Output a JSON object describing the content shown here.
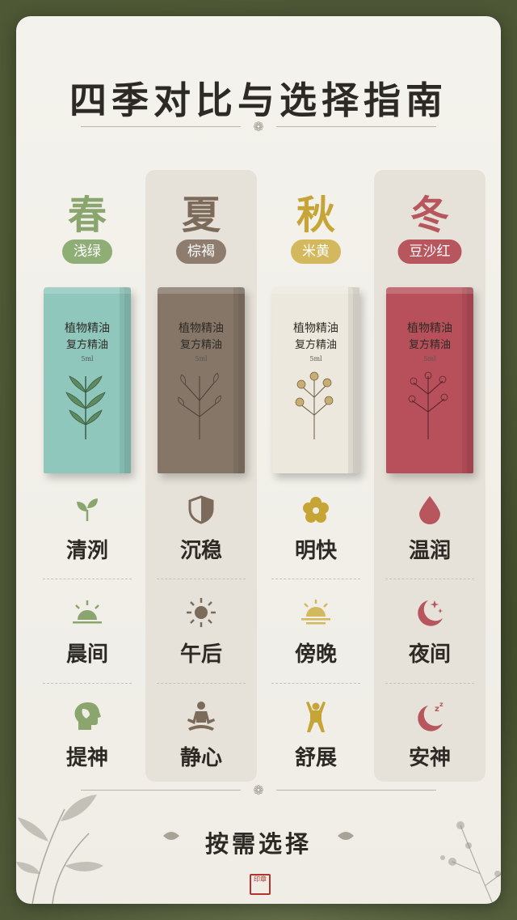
{
  "title": "四季对比与选择指南",
  "footer": "按需选择",
  "seasons": [
    {
      "name": "春",
      "color_name": "浅绿",
      "season_color": "#8aa56d",
      "pill_color": "#8fae76",
      "box_color": "#8fc7bd",
      "box_title_1": "植物精油",
      "box_title_2": "复方精油",
      "box_volume": "5ml",
      "icon_1": "sprout-icon",
      "feature_1": "清洌",
      "icon_2": "sunrise-icon",
      "feature_2": "晨间",
      "icon_3": "head-leaf-icon",
      "feature_3": "提神"
    },
    {
      "name": "夏",
      "color_name": "棕褐",
      "season_color": "#7c6a5b",
      "pill_color": "#8e7d6e",
      "box_color": "#857668",
      "box_title_1": "植物精油",
      "box_title_2": "复方精油",
      "box_volume": "5ml",
      "icon_1": "shield-icon",
      "feature_1": "沉稳",
      "icon_2": "sun-icon",
      "feature_2": "午后",
      "icon_3": "meditation-icon",
      "feature_3": "静心"
    },
    {
      "name": "秋",
      "color_name": "米黄",
      "season_color": "#c6a435",
      "pill_color": "#d4b85e",
      "box_color": "#ece8dd",
      "box_title_1": "植物精油",
      "box_title_2": "复方精油",
      "box_volume": "5ml",
      "icon_1": "flower-icon",
      "feature_1": "明快",
      "icon_2": "sunset-icon",
      "feature_2": "傍晚",
      "icon_3": "stretch-icon",
      "feature_3": "舒展"
    },
    {
      "name": "冬",
      "color_name": "豆沙红",
      "season_color": "#b8565e",
      "pill_color": "#b8565e",
      "box_color": "#b8505b",
      "box_title_1": "植物精油",
      "box_title_2": "复方精油",
      "box_volume": "5ml",
      "icon_1": "drop-icon",
      "feature_1": "温润",
      "icon_2": "moon-stars-icon",
      "feature_2": "夜间",
      "icon_3": "moon-sleep-icon",
      "feature_3": "安神"
    }
  ]
}
